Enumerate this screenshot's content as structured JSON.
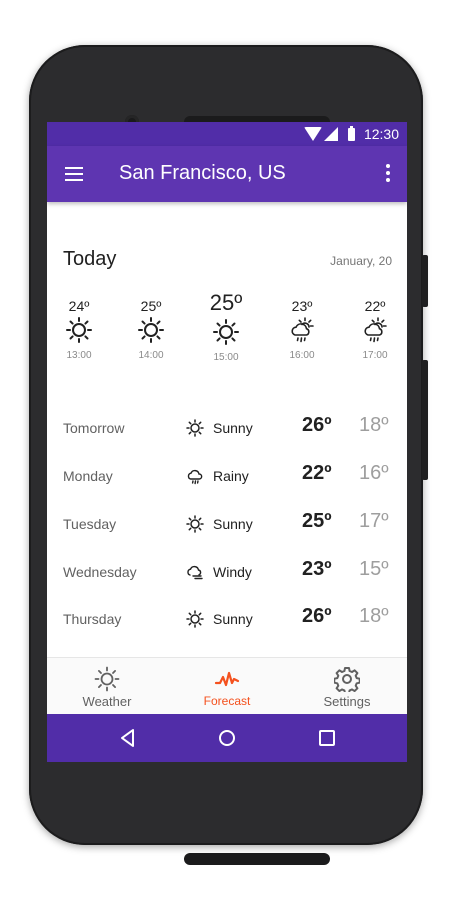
{
  "status_bar": {
    "time": "12:30"
  },
  "app_bar": {
    "title": "San Francisco, US"
  },
  "today": {
    "title": "Today",
    "date": "January, 20",
    "hours": [
      {
        "temp": "24º",
        "time": "13:00",
        "icon": "sun-icon"
      },
      {
        "temp": "25º",
        "time": "14:00",
        "icon": "sun-icon"
      },
      {
        "temp": "25º",
        "time": "15:00",
        "icon": "sun-icon"
      },
      {
        "temp": "23º",
        "time": "16:00",
        "icon": "rain-sun-icon"
      },
      {
        "temp": "22º",
        "time": "17:00",
        "icon": "rain-sun-icon"
      }
    ]
  },
  "forecast": [
    {
      "day": "Tomorrow",
      "condition": "Sunny",
      "icon": "sun-icon",
      "high": "26º",
      "low": "18º"
    },
    {
      "day": "Monday",
      "condition": "Rainy",
      "icon": "rain-icon",
      "high": "22º",
      "low": "16º"
    },
    {
      "day": "Tuesday",
      "condition": "Sunny",
      "icon": "sun-icon",
      "high": "25º",
      "low": "17º"
    },
    {
      "day": "Wednesday",
      "condition": "Windy",
      "icon": "wind-icon",
      "high": "23º",
      "low": "15º"
    },
    {
      "day": "Thursday",
      "condition": "Sunny",
      "icon": "sun-icon",
      "high": "26º",
      "low": "18º"
    }
  ],
  "bottom_nav": {
    "tabs": [
      {
        "label": "Weather",
        "icon": "sun-icon"
      },
      {
        "label": "Forecast",
        "icon": "pulse-icon"
      },
      {
        "label": "Settings",
        "icon": "gear-icon"
      }
    ]
  },
  "colors": {
    "primary": "#5e35b1",
    "primary_dark": "#512da8",
    "accent": "#f4511e"
  }
}
